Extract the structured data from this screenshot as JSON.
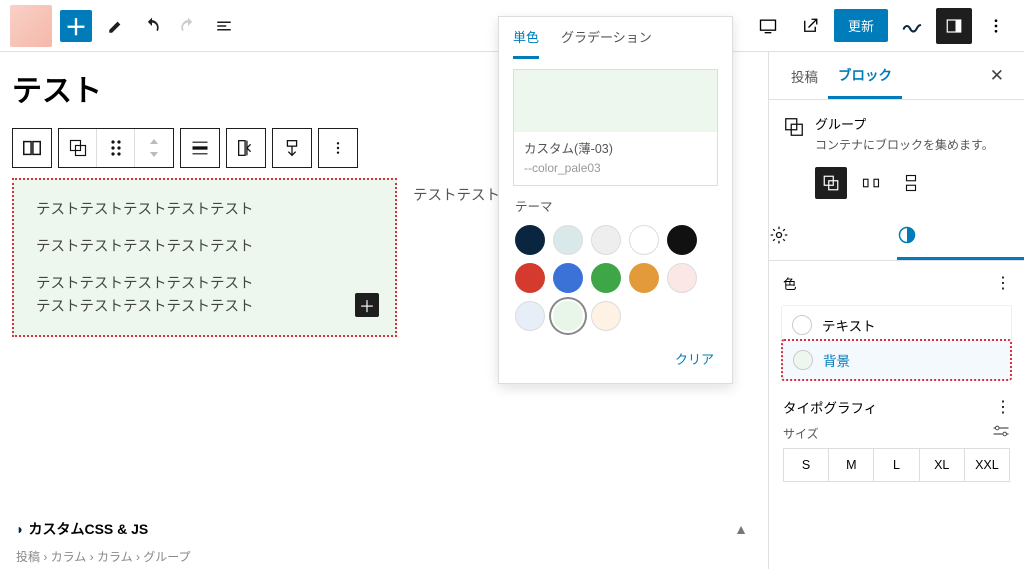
{
  "toolbar": {
    "update_label": "更新"
  },
  "page": {
    "title": "テスト",
    "column1_lines": {
      "l1": "テストテストテストテストテスト",
      "l2": "テストテストテストテストテスト",
      "l3": "テストテストテストテストテスト",
      "l4": "テストテストテストテストテスト"
    },
    "column2_preview": "テストテストテ",
    "custom_css_label": "カスタムCSS & JS",
    "breadcrumb": "投稿 › カラム › カラム › グループ"
  },
  "popover": {
    "tab_solid": "単色",
    "tab_gradient": "グラデーション",
    "swatch_name": "カスタム(薄-03)",
    "swatch_var": "--color_pale03",
    "theme_label": "テーマ",
    "clear_label": "クリア",
    "colors": {
      "c1": "#0a2540",
      "c2": "#d9e9e9",
      "c3": "#eeeeee",
      "c4": "#ffffff",
      "c5": "#111111",
      "c6": "#d53a2f",
      "c7": "#3a72d8",
      "c8": "#3fa648",
      "c9": "#e39a3b",
      "c10": "#fbe7e6",
      "c11": "#e7eef8",
      "c12": "#e8f5e9",
      "c13": "#fdf2e4"
    }
  },
  "sidebar": {
    "tab_post": "投稿",
    "tab_block": "ブロック",
    "block_name": "グループ",
    "block_desc": "コンテナにブロックを集めます。",
    "section_color": "色",
    "color_text": "テキスト",
    "color_background": "背景",
    "section_typo": "タイポグラフィ",
    "size_label": "サイズ",
    "sizes": {
      "s": "S",
      "m": "M",
      "l": "L",
      "xl": "XL",
      "xxl": "XXL"
    }
  }
}
